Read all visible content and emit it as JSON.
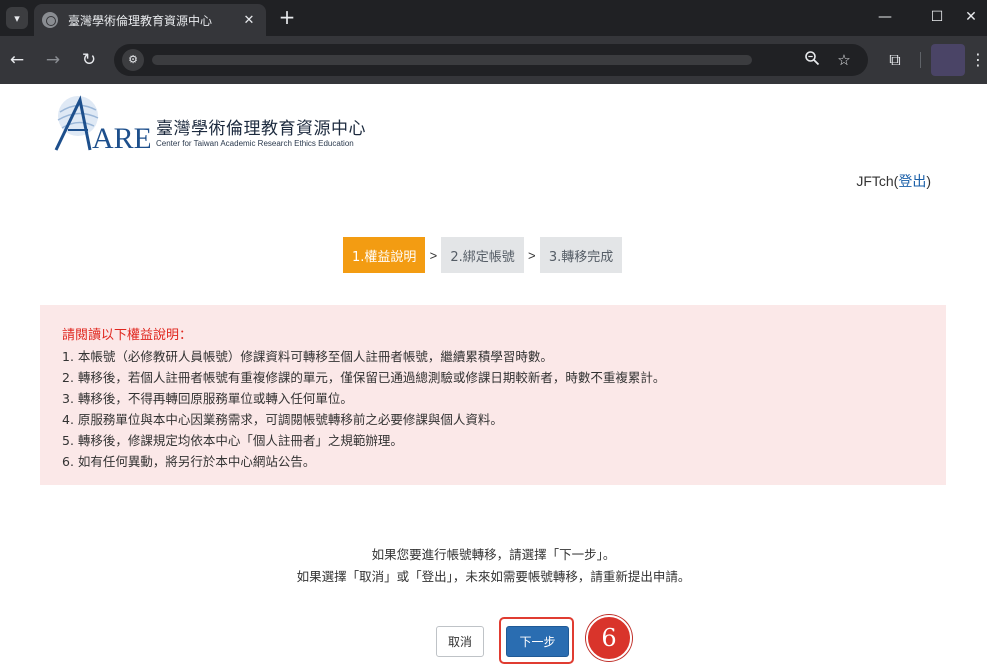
{
  "browser": {
    "tab_title": "臺灣學術倫理教育資源中心",
    "tab_close": "✕",
    "new_tab": "+",
    "menu_icon": "chevron-down-icon",
    "window_controls": {
      "minimize": "—",
      "maximize": "☐",
      "close": "✕"
    }
  },
  "site": {
    "logo_mark": "AREE",
    "name_cn": "臺灣學術倫理教育資源中心",
    "name_en": "Center for Taiwan Academic Research Ethics Education"
  },
  "user": {
    "name": "JFTch",
    "open_paren": "(",
    "logout": "登出",
    "close_paren": ")"
  },
  "steps": {
    "items": [
      {
        "label": "1.權益說明",
        "active": true
      },
      {
        "label": "2.綁定帳號",
        "active": false
      },
      {
        "label": "3.轉移完成",
        "active": false
      }
    ],
    "separator": ">"
  },
  "notice": {
    "title": "請閱讀以下權益說明：",
    "items": [
      "1. 本帳號（必修教研人員帳號）修課資料可轉移至個人註冊者帳號，繼續累積學習時數。",
      "2. 轉移後，若個人註冊者帳號有重複修課的單元，僅保留已通過總測驗或修課日期較新者，時數不重複累計。",
      "3. 轉移後，不得再轉回原服務單位或轉入任何單位。",
      "4. 原服務單位與本中心因業務需求，可調閱帳號轉移前之必要修課與個人資料。",
      "5. 轉移後，修課規定均依本中心「個人註冊者」之規範辦理。",
      "6. 如有任何異動，將另行於本中心網站公告。"
    ]
  },
  "prompt": {
    "line1": "如果您要進行帳號轉移，請選擇「下一步」。",
    "line2": "如果選擇「取消」或「登出」，未來如需要帳號轉移，請重新提出申請。"
  },
  "buttons": {
    "cancel": "取消",
    "next": "下一步"
  },
  "annotation": {
    "marker": "6"
  },
  "colors": {
    "step_active": "#f39c12",
    "notice_bg": "#fbe8e8",
    "notice_title": "#e0261e",
    "next_button": "#2a6db1",
    "highlight": "#e03c31"
  }
}
